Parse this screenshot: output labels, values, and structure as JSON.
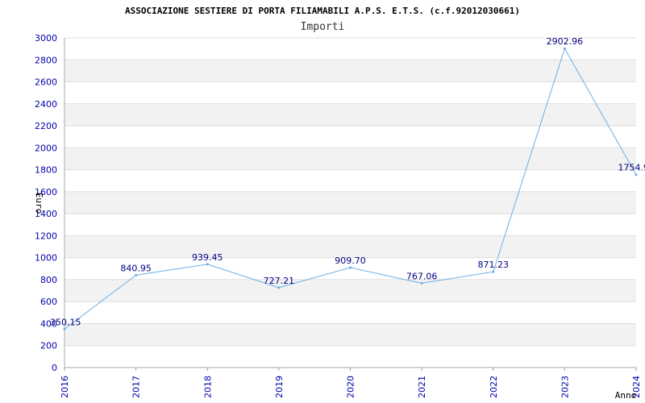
{
  "chart_data": {
    "type": "line",
    "title": "ASSOCIAZIONE SESTIERE DI PORTA FILIAMABILI A.P.S. E.T.S. (c.f.92012030661)",
    "subtitle": "Importi",
    "xlabel": "Anno",
    "ylabel": "Euro",
    "categories": [
      "2016",
      "2017",
      "2018",
      "2019",
      "2020",
      "2021",
      "2022",
      "2023",
      "2024"
    ],
    "values": [
      350.15,
      840.95,
      939.45,
      727.21,
      909.7,
      767.06,
      871.23,
      2902.96,
      1754.9
    ],
    "data_labels": [
      "350.15",
      "840.95",
      "939.45",
      "727.21",
      "909.70",
      "767.06",
      "871.23",
      "2902.96",
      "1754.9"
    ],
    "ylim": [
      0,
      3000
    ],
    "yticks": [
      "0",
      "200",
      "400",
      "600",
      "800",
      "1000",
      "1200",
      "1400",
      "1600",
      "1800",
      "2000",
      "2200",
      "2400",
      "2600",
      "2800",
      "3000"
    ],
    "grid": true,
    "colors": {
      "line": "#6aaee8",
      "band": "#f2f2f2",
      "gridline": "#dddddd",
      "tick": "#0000aa",
      "data_label": "#000080"
    }
  }
}
